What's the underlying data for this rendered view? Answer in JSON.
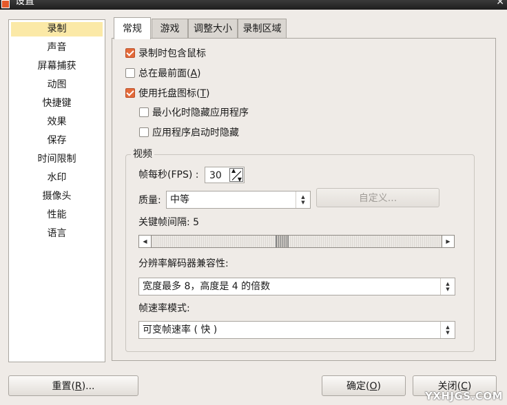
{
  "window": {
    "title": "设置",
    "close_glyph": "✕"
  },
  "sidebar": {
    "items": [
      {
        "label": "录制",
        "selected": true
      },
      {
        "label": "声音"
      },
      {
        "label": "屏幕捕获"
      },
      {
        "label": "动图"
      },
      {
        "label": "快捷键"
      },
      {
        "label": "效果"
      },
      {
        "label": "保存"
      },
      {
        "label": "时间限制"
      },
      {
        "label": "水印"
      },
      {
        "label": "摄像头"
      },
      {
        "label": "性能"
      },
      {
        "label": "语言"
      }
    ]
  },
  "tabs": [
    {
      "label": "常规",
      "active": true
    },
    {
      "label": "游戏"
    },
    {
      "label": "调整大小"
    },
    {
      "label": "录制区域"
    }
  ],
  "general": {
    "include_cursor": {
      "label": "录制时包含鼠标",
      "checked": true
    },
    "always_on_top": {
      "label_pre": "总在最前面(",
      "mnemonic": "A",
      "label_post": ")",
      "checked": false
    },
    "tray_icon": {
      "label_pre": "使用托盘图标(",
      "mnemonic": "T",
      "label_post": ")",
      "checked": true
    },
    "hide_minimized": {
      "label": "最小化时隐藏应用程序",
      "checked": false
    },
    "hide_on_start": {
      "label": "应用程序启动时隐藏",
      "checked": false
    }
  },
  "video": {
    "group_title": "视频",
    "fps_label": "帧每秒(FPS) :",
    "fps_value": "30",
    "quality_label": "质量:",
    "quality_value": "中等",
    "custom_button": "自定义...",
    "keyframe_label": "关键帧间隔: 5",
    "keyframe_value": 5,
    "resolution_label": "分辨率解码器兼容性:",
    "resolution_value": "宽度最多 8，高度是 4 的倍数",
    "framerate_label": "帧速率模式:",
    "framerate_value": "可变帧速率 ( 快 )"
  },
  "footer": {
    "reset": {
      "pre": "重置(",
      "mnemonic": "R",
      "post": ")..."
    },
    "ok": {
      "pre": "确定(",
      "mnemonic": "O",
      "post": ")"
    },
    "close": {
      "pre": "关闭(",
      "mnemonic": "C",
      "post": ")"
    }
  },
  "watermark": "YXHJGS.COM",
  "colors": {
    "accent_check": "#e46a3a",
    "selected_item": "#fbe9a7"
  },
  "icons": {
    "spin": "spin-arrows-icon",
    "combo": "combo-arrows-icon"
  }
}
